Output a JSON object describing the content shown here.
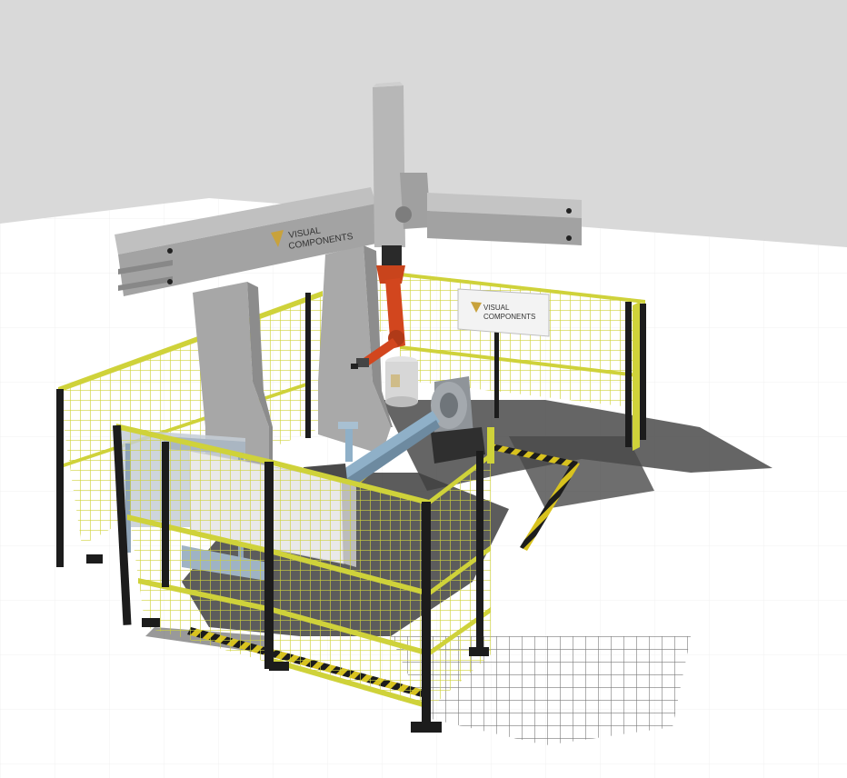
{
  "scene": {
    "background_color": "#d9d9d9",
    "floor_color": "#ffffff",
    "floor_grid_color": "#e6e6e6"
  },
  "branding": {
    "line1": "VISUAL",
    "line2": "COMPONENTS",
    "logo_mark": "v-chevron-icon",
    "logo_color": "#c8a23c"
  },
  "colors": {
    "gantry": "#a7a7a7",
    "gantry_light": "#bdbdbd",
    "gantry_dark": "#8c8c8c",
    "fence_mesh": "#cfd23a",
    "fence_post": "#1c1c1c",
    "robot": "#d2461e",
    "positioner": "#9aa0a6",
    "blue_shaft": "#8fb0c8",
    "shadow": "#3a3a3a"
  }
}
